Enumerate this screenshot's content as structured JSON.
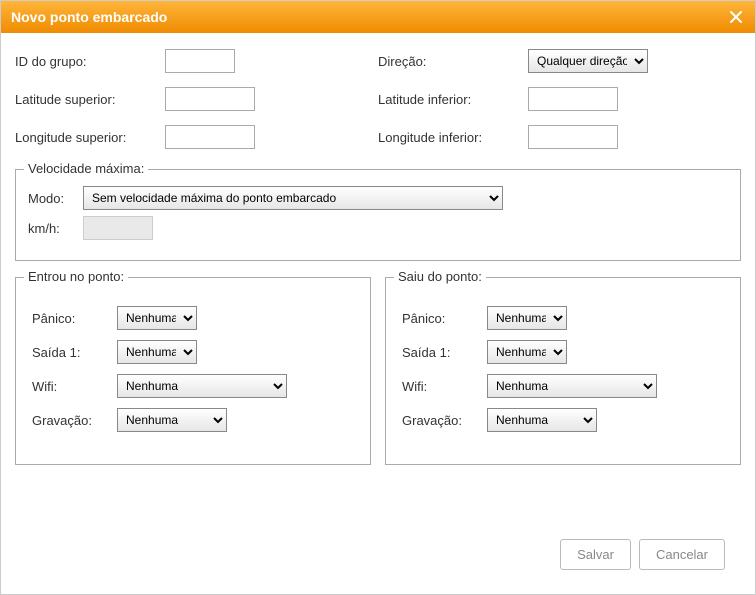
{
  "dialog": {
    "title": "Novo ponto embarcado",
    "labels": {
      "group_id": "ID do grupo:",
      "direction": "Direção:",
      "lat_sup": "Latitude superior:",
      "lat_inf": "Latitude inferior:",
      "lon_sup": "Longitude superior:",
      "lon_inf": "Longitude inferior:"
    },
    "values": {
      "group_id": "",
      "lat_sup": "",
      "lat_inf": "",
      "lon_sup": "",
      "lon_inf": ""
    },
    "direction_selected": "Qualquer direção"
  },
  "speed": {
    "legend": "Velocidade máxima:",
    "mode_label": "Modo:",
    "mode_selected": "Sem velocidade máxima do ponto embarcado",
    "kmh_label": "km/h:",
    "kmh_value": ""
  },
  "entered": {
    "legend": "Entrou no ponto:",
    "panic_label": "Pânico:",
    "panic_selected": "Nenhuma",
    "out1_label": "Saída 1:",
    "out1_selected": "Nenhuma",
    "wifi_label": "Wifi:",
    "wifi_selected": "Nenhuma",
    "rec_label": "Gravação:",
    "rec_selected": "Nenhuma"
  },
  "left": {
    "legend": "Saiu do ponto:",
    "panic_label": "Pânico:",
    "panic_selected": "Nenhuma",
    "out1_label": "Saída 1:",
    "out1_selected": "Nenhuma",
    "wifi_label": "Wifi:",
    "wifi_selected": "Nenhuma",
    "rec_label": "Gravação:",
    "rec_selected": "Nenhuma"
  },
  "footer": {
    "save": "Salvar",
    "cancel": "Cancelar"
  }
}
